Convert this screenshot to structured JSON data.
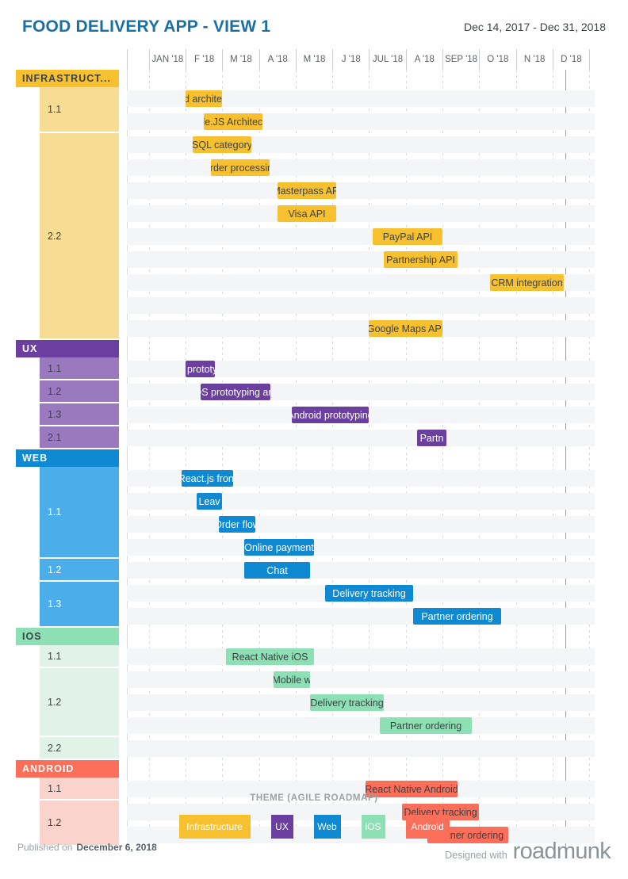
{
  "header": {
    "title": "FOOD DELIVERY APP - VIEW 1",
    "date_range": "Dec 14, 2017 - Dec 31, 2018",
    "title_color": "#1a6fa3"
  },
  "timeline": {
    "months": [
      "JAN '18",
      "F '18",
      "M '18",
      "A '18",
      "M '18",
      "J '18",
      "JUL '18",
      "A '18",
      "SEP '18",
      "O '18",
      "N '18",
      "D '18"
    ]
  },
  "colors": {
    "infrastructure": "#f7c02e",
    "infrastructure_sub": "#f7dc94",
    "ux": "#6b3fa0",
    "ux_sub": "#9b79bf",
    "web": "#1089d3",
    "web_sub": "#4cadeb",
    "ios": "#8ce0b4",
    "ios_sub": "#e1f3e9",
    "android": "#fa6e5a",
    "android_sub": "#fad3cd",
    "today_marker": "#f4767a",
    "row_stripe": "#f4f5f6"
  },
  "groups": [
    {
      "name": "INFRASTRUCT...",
      "key": "infrastructure",
      "subgroups": [
        {
          "label": "1.1",
          "rows": 2
        },
        {
          "label": "2.2",
          "rows": 9
        }
      ],
      "bars": [
        {
          "label": "Cloud architecture",
          "row": 0,
          "start": 1.0,
          "end": 2.0
        },
        {
          "label": "Node.JS Architecture",
          "row": 1,
          "start": 1.5,
          "end": 3.1
        },
        {
          "label": "SQL category",
          "row": 2,
          "start": 1.2,
          "end": 2.8
        },
        {
          "label": "Order processing",
          "row": 3,
          "start": 1.7,
          "end": 3.3
        },
        {
          "label": "Masterpass API",
          "row": 4,
          "start": 3.5,
          "end": 5.1
        },
        {
          "label": "Visa API",
          "row": 5,
          "start": 3.5,
          "end": 5.1
        },
        {
          "label": "PayPal API",
          "row": 6,
          "start": 6.1,
          "end": 8.0
        },
        {
          "label": "Partnership API",
          "row": 7,
          "start": 6.4,
          "end": 8.4
        },
        {
          "label": "CRM integration",
          "row": 8,
          "start": 9.3,
          "end": 11.3
        },
        {
          "label": "Google Maps API",
          "row": 10,
          "start": 6.0,
          "end": 8.0
        }
      ]
    },
    {
      "name": "UX",
      "key": "ux",
      "subgroups": [
        {
          "label": "1.1",
          "rows": 1
        },
        {
          "label": "1.2",
          "rows": 1
        },
        {
          "label": "1.3",
          "rows": 1
        },
        {
          "label": "2.1",
          "rows": 1
        }
      ],
      "bars": [
        {
          "label": "Web prototyping",
          "row": 0,
          "start": 1.0,
          "end": 1.8
        },
        {
          "label": "iOS prototyping and",
          "row": 1,
          "start": 1.4,
          "end": 3.3
        },
        {
          "label": "Android prototyping",
          "row": 2,
          "start": 3.9,
          "end": 6.0
        },
        {
          "label": "Partn",
          "row": 3,
          "start": 7.3,
          "end": 8.1
        }
      ]
    },
    {
      "name": "WEB",
      "key": "web",
      "subgroups": [
        {
          "label": "1.1",
          "rows": 4
        },
        {
          "label": "1.2",
          "rows": 1
        },
        {
          "label": "1.3",
          "rows": 2
        }
      ],
      "bars": [
        {
          "label": "React.js front",
          "row": 0,
          "start": 0.9,
          "end": 2.3
        },
        {
          "label": "Leav",
          "row": 1,
          "start": 1.3,
          "end": 2.0
        },
        {
          "label": "Order flow",
          "row": 2,
          "start": 1.9,
          "end": 2.9
        },
        {
          "label": "Online payment",
          "row": 3,
          "start": 2.6,
          "end": 4.5
        },
        {
          "label": "Chat",
          "row": 4,
          "start": 2.6,
          "end": 4.4
        },
        {
          "label": "Delivery tracking",
          "row": 5,
          "start": 4.8,
          "end": 7.2
        },
        {
          "label": "Partner ordering",
          "row": 6,
          "start": 7.2,
          "end": 9.6
        }
      ]
    },
    {
      "name": "IOS",
      "key": "ios",
      "subgroups": [
        {
          "label": "1.1",
          "rows": 1
        },
        {
          "label": "1.2",
          "rows": 3
        },
        {
          "label": "2.2",
          "rows": 1
        }
      ],
      "bars": [
        {
          "label": "React Native iOS",
          "row": 0,
          "start": 2.1,
          "end": 4.5
        },
        {
          "label": "Mobile w",
          "row": 1,
          "start": 3.4,
          "end": 4.4
        },
        {
          "label": "Delivery tracking",
          "row": 2,
          "start": 4.4,
          "end": 6.4
        },
        {
          "label": "Partner ordering",
          "row": 3,
          "start": 6.3,
          "end": 8.8
        }
      ]
    },
    {
      "name": "ANDROID",
      "key": "android",
      "subgroups": [
        {
          "label": "1.1",
          "rows": 1
        },
        {
          "label": "1.2",
          "rows": 2
        }
      ],
      "bars": [
        {
          "label": "React Native Android",
          "row": 0,
          "start": 5.9,
          "end": 8.4
        },
        {
          "label": "Delivery tracking",
          "row": 1,
          "start": 6.9,
          "end": 9.0
        },
        {
          "label": "Partner ordering",
          "row": 2,
          "start": 7.6,
          "end": 9.8
        }
      ]
    }
  ],
  "footer": {
    "theme_title": "THEME (AGILE ROADMAP)",
    "legend": [
      {
        "label": "Infrastructure",
        "color": "#f7c02e"
      },
      {
        "label": "UX",
        "color": "#6b3fa0"
      },
      {
        "label": "Web",
        "color": "#1089d3"
      },
      {
        "label": "iOS",
        "color": "#8ce0b4"
      },
      {
        "label": "Android",
        "color": "#fa6e5a"
      }
    ],
    "published_prefix": "Published on",
    "published_date": "December 6, 2018",
    "designed_prefix": "Designed with",
    "brand": "roadmunk"
  }
}
